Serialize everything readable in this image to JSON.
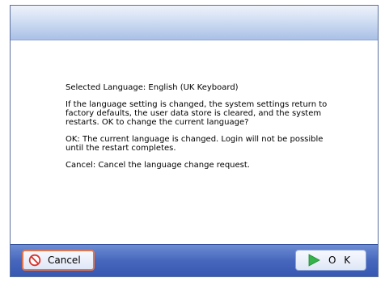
{
  "message": {
    "selected_language": "Selected Language: English (UK Keyboard)",
    "warning": "If the language setting is changed, the system settings return to factory defaults, the user data store is cleared, and the system restarts. OK to change the current language?",
    "ok_explanation": "OK: The current language is changed. Login will not be possible until the restart completes.",
    "cancel_explanation": "Cancel: Cancel the language change request."
  },
  "footer": {
    "cancel_label": "Cancel",
    "ok_label": "O K",
    "cancel_icon": "prohibit-icon",
    "ok_icon": "play-arrow-icon"
  },
  "colors": {
    "footer_bar": "#4767bd",
    "cancel_focus_border": "#e0764d",
    "cancel_icon": "#d9302a",
    "ok_icon": "#35b34a"
  }
}
